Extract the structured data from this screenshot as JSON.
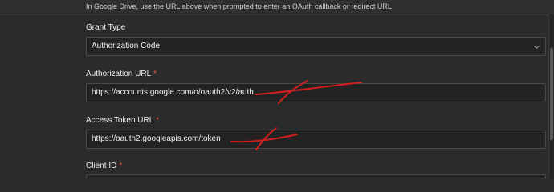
{
  "hint_text": "In Google Drive, use the URL above when prompted to enter an OAuth callback or redirect URL",
  "grant_type": {
    "label": "Grant Type",
    "value": "Authorization Code",
    "icon": "chevron-down-icon"
  },
  "authorization_url": {
    "label": "Authorization URL",
    "required_marker": "*",
    "value": "https://accounts.google.com/o/oauth2/v2/auth"
  },
  "access_token_url": {
    "label": "Access Token URL",
    "required_marker": "*",
    "value": "https://oauth2.googleapis.com/token"
  },
  "client_id": {
    "label": "Client ID",
    "required_marker": "*"
  },
  "colors": {
    "background": "#2b2b2b",
    "field_background": "#232323",
    "required": "#e0564a",
    "annotation_ink": "#d11f1f"
  }
}
